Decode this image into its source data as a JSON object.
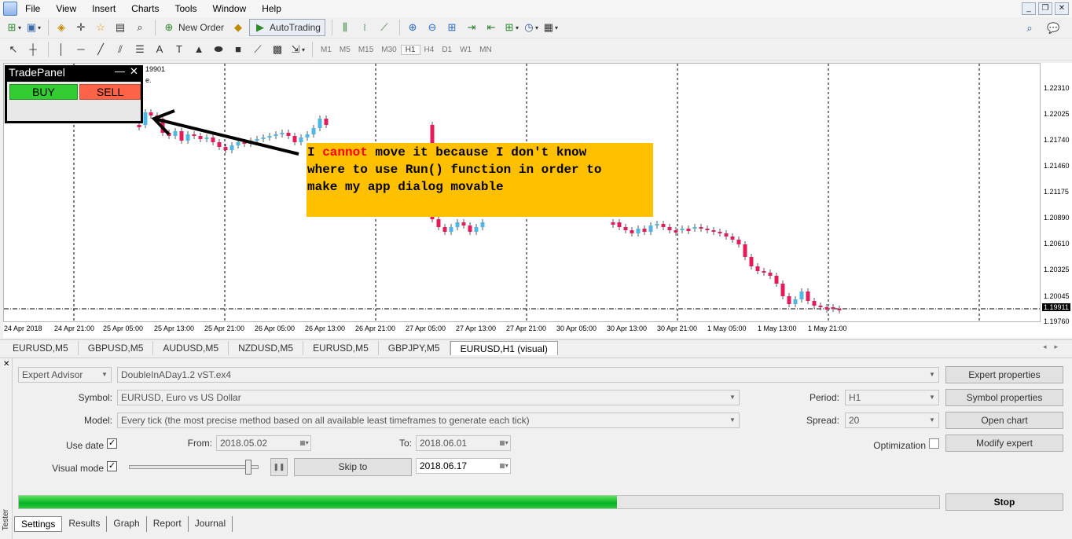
{
  "menu": {
    "items": [
      "File",
      "View",
      "Insert",
      "Charts",
      "Tools",
      "Window",
      "Help"
    ]
  },
  "toolbar": {
    "new_order_label": "New Order",
    "autotrading_label": "AutoTrading",
    "timeframes": [
      "M1",
      "M5",
      "M15",
      "M30",
      "H1",
      "H4",
      "D1",
      "W1",
      "MN"
    ],
    "active_timeframe": "H1"
  },
  "chart": {
    "price_labels": [
      "1.22310",
      "1.22025",
      "1.21740",
      "1.21460",
      "1.21175",
      "1.20890",
      "1.20610",
      "1.20325",
      "1.20045",
      "1.19760"
    ],
    "current_price": "1.19911",
    "time_labels": [
      "24 Apr 2018",
      "24 Apr 21:00",
      "25 Apr 05:00",
      "25 Apr 13:00",
      "25 Apr 21:00",
      "26 Apr 05:00",
      "26 Apr 13:00",
      "26 Apr 21:00",
      "27 Apr 05:00",
      "27 Apr 13:00",
      "27 Apr 21:00",
      "30 Apr 05:00",
      "30 Apr 13:00",
      "30 Apr 21:00",
      "1 May 05:00",
      "1 May 13:00",
      "1 May 21:00"
    ],
    "header_fragment": "19901",
    "header_fragment2": "e.",
    "up_color": "#4db8e8",
    "down_color": "#e8195a"
  },
  "trade_panel": {
    "title": "TradePanel",
    "minimize": "—",
    "close": "✕",
    "buy_label": "BUY",
    "sell_label": "SELL"
  },
  "annotation": {
    "part1": "I ",
    "highlight": "cannot",
    "part2": " move it because I don't know",
    "line2": "where to use Run() function in order to",
    "line3": "make my app dialog movable"
  },
  "chart_tabs": [
    "EURUSD,M5",
    "GBPUSD,M5",
    "AUDUSD,M5",
    "NZDUSD,M5",
    "EURUSD,M5",
    "GBPJPY,M5",
    "EURUSD,H1 (visual)"
  ],
  "tester": {
    "side_label": "Tester",
    "expert_type": "Expert Advisor",
    "expert_file": "DoubleInADay1.2 vST.ex4",
    "symbol_label": "Symbol:",
    "symbol_value": "EURUSD, Euro vs US Dollar",
    "model_label": "Model:",
    "model_value": "Every tick (the most precise method based on all available least timeframes to generate each tick)",
    "use_date_label": "Use date",
    "from_label": "From:",
    "from_value": "2018.05.02",
    "to_label": "To:",
    "to_value": "2018.06.01",
    "visual_mode_label": "Visual mode",
    "skip_to_label": "Skip to",
    "skip_date": "2018.06.17",
    "period_label": "Period:",
    "period_value": "H1",
    "spread_label": "Spread:",
    "spread_value": "20",
    "optimization_label": "Optimization",
    "expert_properties": "Expert properties",
    "symbol_properties": "Symbol properties",
    "open_chart": "Open chart",
    "modify_expert": "Modify expert",
    "stop_label": "Stop",
    "progress": 0.65,
    "check_mark": "✓",
    "pause_glyph": "❚❚",
    "bottom_tabs": [
      "Settings",
      "Results",
      "Graph",
      "Report",
      "Journal"
    ]
  }
}
